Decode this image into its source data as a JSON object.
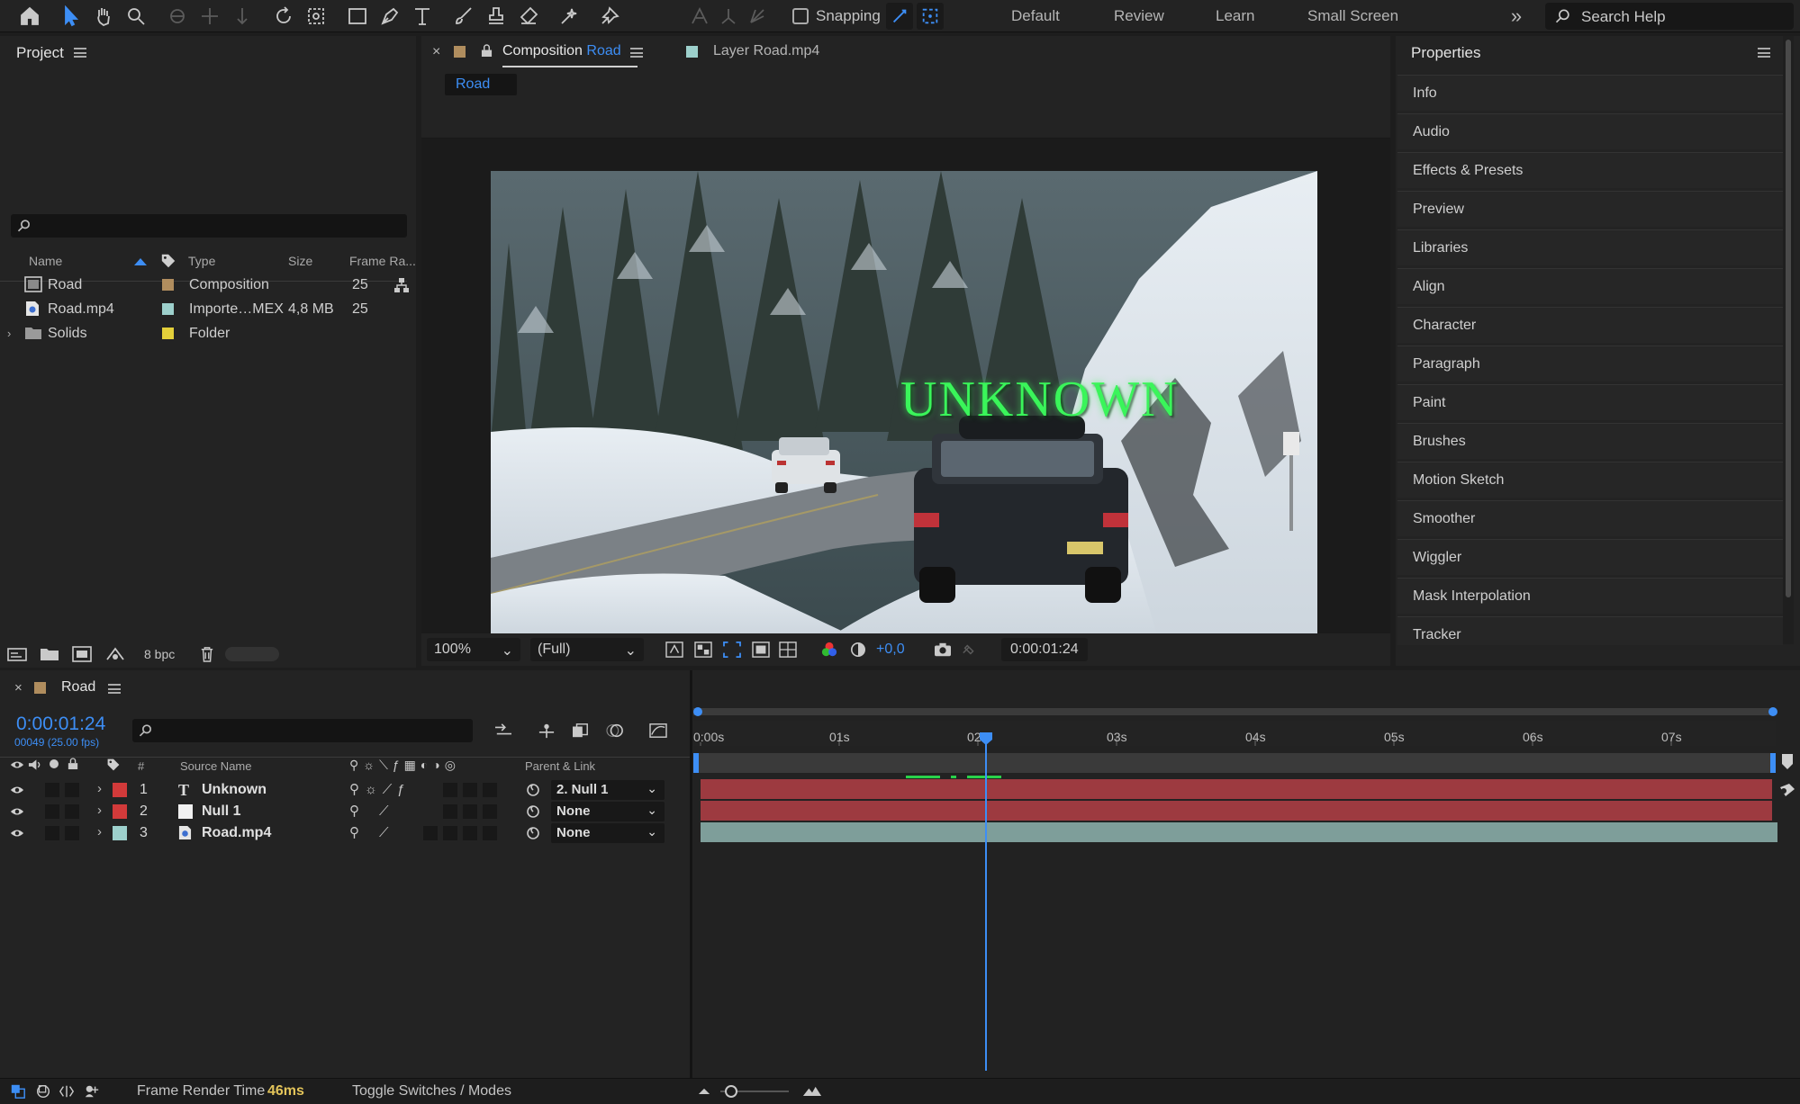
{
  "toolbar": {
    "snapping_label": "Snapping",
    "workspaces": [
      "Default",
      "Review",
      "Learn",
      "Small Screen"
    ],
    "search_placeholder": "Search Help",
    "accent": "#3d8ef5"
  },
  "project": {
    "title": "Project",
    "search_value": "",
    "columns": {
      "name": "Name",
      "type": "Type",
      "size": "Size",
      "frame_rate": "Frame Ra..."
    },
    "items": [
      {
        "name": "Road",
        "type": "Composition",
        "size": "",
        "frame_rate": "25",
        "color": "#b08d5e",
        "icon": "composition-icon"
      },
      {
        "name": "Road.mp4",
        "type": "Importe…MEX",
        "size": "4,8 MB",
        "frame_rate": "25",
        "color": "#9dd0cc",
        "icon": "footage-icon"
      },
      {
        "name": "Solids",
        "type": "Folder",
        "size": "",
        "frame_rate": "",
        "color": "#e3cf3a",
        "icon": "folder-icon"
      }
    ],
    "bpc": "8 bpc"
  },
  "composition": {
    "tab_prefix": "Composition",
    "tab_name": "Road",
    "layer_tab": "Layer Road.mp4",
    "breadcrumb": "Road",
    "overlay_text": "UNKNOWN",
    "zoom": "100%",
    "resolution": "(Full)",
    "exposure": "+0,0",
    "timecode": "0:00:01:24"
  },
  "properties": {
    "title": "Properties",
    "items": [
      "Info",
      "Audio",
      "Effects & Presets",
      "Preview",
      "Libraries",
      "Align",
      "Character",
      "Paragraph",
      "Paint",
      "Brushes",
      "Motion Sketch",
      "Smoother",
      "Wiggler",
      "Mask Interpolation",
      "Tracker"
    ]
  },
  "timeline": {
    "comp_name": "Road",
    "current_time": "0:00:01:24",
    "frame_info": "00049 (25.00 fps)",
    "search_value": "",
    "columns": {
      "number": "#",
      "source_name": "Source Name",
      "parent": "Parent & Link"
    },
    "layers": [
      {
        "index": "1",
        "name": "Unknown",
        "type_icon": "text-layer-icon",
        "label_color": "#d23a3a",
        "parent": "2. Null 1",
        "bar_color": "#9d3a40"
      },
      {
        "index": "2",
        "name": "Null 1",
        "type_icon": "null-layer-icon",
        "label_color": "#d23a3a",
        "parent": "None",
        "bar_color": "#9d3a40"
      },
      {
        "index": "3",
        "name": "Road.mp4",
        "type_icon": "footage-icon",
        "label_color": "#9dd0cc",
        "parent": "None",
        "bar_color": "#7e9e9a"
      }
    ],
    "ruler_labels": [
      "0:00s",
      "01s",
      "02s",
      "03s",
      "04s",
      "05s",
      "06s",
      "07s"
    ],
    "playhead_fraction": 0.266
  },
  "statusbar": {
    "render_label": "Frame Render Time",
    "render_value": "46ms",
    "toggle_label": "Toggle Switches / Modes"
  }
}
